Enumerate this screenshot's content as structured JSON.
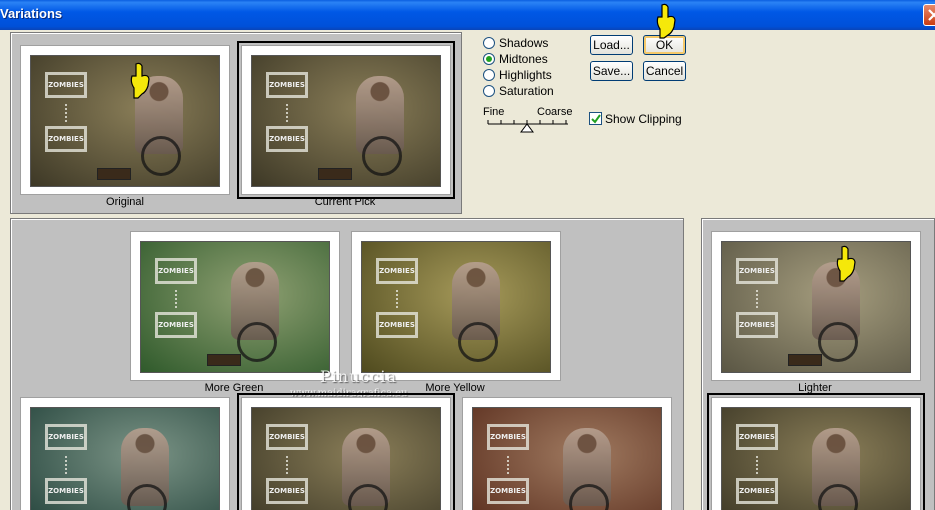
{
  "window": {
    "title": "Variations"
  },
  "top": {
    "original_label": "Original",
    "current_label": "Current Pick"
  },
  "options": {
    "radios": [
      {
        "label": "Shadows",
        "selected": false
      },
      {
        "label": "Midtones",
        "selected": true
      },
      {
        "label": "Highlights",
        "selected": false
      },
      {
        "label": "Saturation",
        "selected": false
      }
    ],
    "fine_label": "Fine",
    "coarse_label": "Coarse",
    "show_clipping_label": "Show Clipping",
    "show_clipping_checked": true
  },
  "buttons": {
    "ok": "OK",
    "cancel": "Cancel",
    "load": "Load...",
    "save": "Save..."
  },
  "variants": {
    "more_green": "More Green",
    "more_yellow": "More Yellow",
    "lighter": "Lighter"
  },
  "thumb_text": "ZOMBIES",
  "watermark": {
    "name": "Pinuccia",
    "url": "www.maidiragrafica.eu"
  },
  "colors": {
    "titlebar": "#0058e6",
    "dialog_bg": "#ece9d8",
    "panel_bg": "#c0c0c0",
    "tint_original": "#5a5238",
    "tint_green": "#3f6b35",
    "tint_yellow": "#6b6228",
    "tint_lighter": "#6e6a58",
    "tint_cyan": "#3c5a52",
    "tint_red": "#6a3a28"
  },
  "icons": [
    "close-icon",
    "pointing-hand-icon",
    "checkmark-icon",
    "slider-pointer-icon"
  ]
}
